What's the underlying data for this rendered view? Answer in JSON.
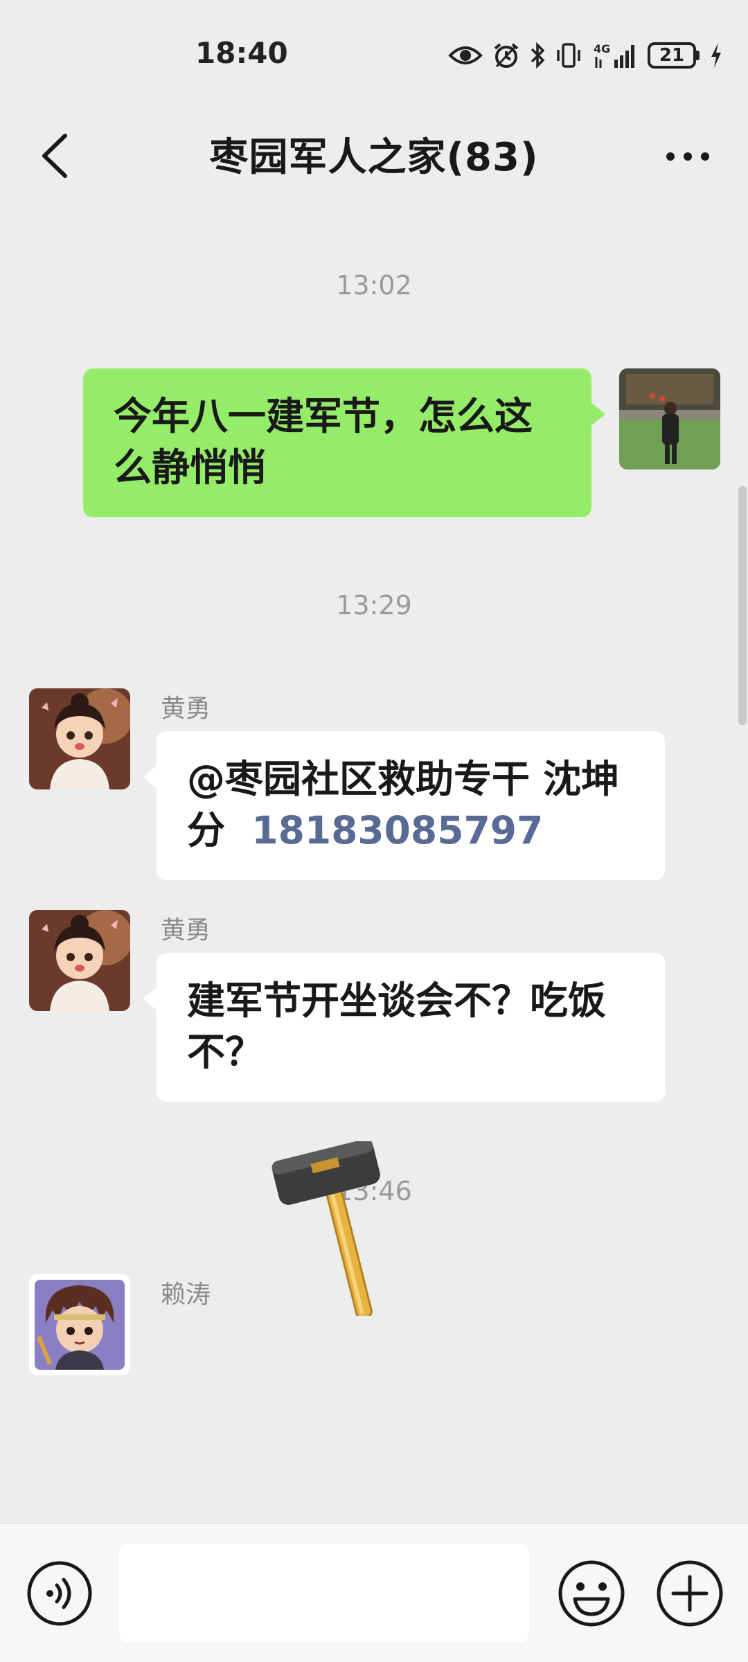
{
  "status_bar": {
    "time": "18:40",
    "network": "4G",
    "battery": "21",
    "icons": [
      "eye-icon",
      "alarm-icon",
      "bluetooth-icon",
      "vibrate-icon",
      "signal-icon",
      "battery-icon",
      "charging-icon"
    ]
  },
  "header": {
    "title": "枣园军人之家(83)",
    "back_icon": "chevron-left-icon",
    "more_icon": "more-dots-icon"
  },
  "messages": [
    {
      "type": "timestamp",
      "text": "13:02"
    },
    {
      "type": "outgoing",
      "text": "今年八一建军节，怎么这么静悄悄"
    },
    {
      "type": "timestamp",
      "text": "13:29"
    },
    {
      "type": "incoming",
      "sender": "黄勇",
      "mention": "@枣园社区救助专干  沈坤分",
      "phone": "18183085797"
    },
    {
      "type": "incoming",
      "sender": "黄勇",
      "text": "建军节开坐谈会不？吃饭不？"
    },
    {
      "type": "timestamp",
      "text": "13:46"
    },
    {
      "type": "incoming-sticker",
      "sender": "赖涛",
      "sticker": "hammer-sticker"
    }
  ],
  "input_bar": {
    "voice_icon": "voice-icon",
    "placeholder": "",
    "emoji_icon": "emoji-icon",
    "plus_icon": "plus-icon"
  },
  "colors": {
    "background": "#ededed",
    "outgoing_bubble": "#95ec69",
    "incoming_bubble": "#ffffff",
    "link": "#576b95",
    "timestamp": "#9a9a9a"
  }
}
